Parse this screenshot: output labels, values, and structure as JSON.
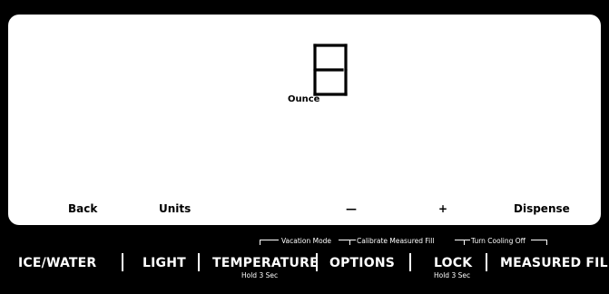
{
  "display": {
    "digit_value": "8",
    "unit": "Ounce"
  },
  "soft_buttons": {
    "back": "Back",
    "units": "Units",
    "minus": "—",
    "plus": "+",
    "dispense": "Dispense"
  },
  "hold_functions": {
    "vacation_mode": "Vacation Mode",
    "calibrate_measured_fill": "Calibrate Measured Fill",
    "turn_cooling_off": "Turn Cooling Off"
  },
  "buttons": {
    "ice_water": "ICE/WATER",
    "light": "LIGHT",
    "temperature": "TEMPERATURE",
    "temperature_sub": "Hold 3 Sec",
    "options": "OPTIONS",
    "lock": "LOCK",
    "lock_sub": "Hold 3 Sec",
    "measured_fill": "MEASURED FILL"
  },
  "colors": {
    "background": "#000000",
    "panel": "#ffffff"
  }
}
